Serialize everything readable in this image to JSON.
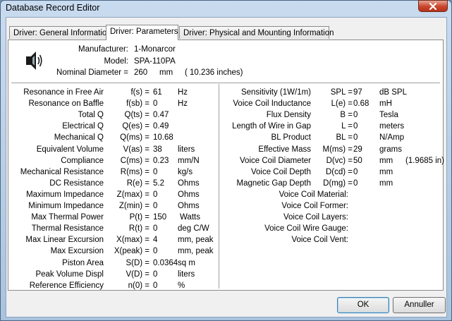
{
  "window": {
    "title": "Database Record Editor"
  },
  "tabs": [
    {
      "label": "Driver:  General Information"
    },
    {
      "label": "Driver:  Parameters"
    },
    {
      "label": "Driver:  Physical and Mounting Information"
    }
  ],
  "header": {
    "manufacturer_label": "Manufacturer:",
    "manufacturer_value": "1-Monarcor",
    "model_label": "Model:",
    "model_value": "SPA-110PA",
    "diameter_label": "Nominal Diameter =",
    "diameter_value": "260",
    "diameter_unit": "mm",
    "diameter_inches": "( 10.236 inches)"
  },
  "left_params": [
    {
      "label": "Resonance in Free Air",
      "sym": "f(s) =",
      "value": "61",
      "unit": "Hz"
    },
    {
      "label": "Resonance on Baffle",
      "sym": "f(sb) =",
      "value": "0",
      "unit": "Hz"
    },
    {
      "label": "Total Q",
      "sym": "Q(ts) =",
      "value": "0.47",
      "unit": ""
    },
    {
      "label": "Electrical Q",
      "sym": "Q(es) =",
      "value": "0.49",
      "unit": ""
    },
    {
      "label": "Mechanical Q",
      "sym": "Q(ms) =",
      "value": "10.68",
      "unit": ""
    },
    {
      "label": "Equivalent Volume",
      "sym": "V(as) =",
      "value": "38",
      "unit": "liters"
    },
    {
      "label": "Compliance",
      "sym": "C(ms) =",
      "value": "0.23",
      "unit": "mm/N"
    },
    {
      "label": "Mechanical Resistance",
      "sym": "R(ms) =",
      "value": "0",
      "unit": "kg/s"
    },
    {
      "label": "DC Resistance",
      "sym": "R(e) =",
      "value": "5.2",
      "unit": "Ohms"
    },
    {
      "label": "Maximum Impedance",
      "sym": "Z(max) =",
      "value": "0",
      "unit": "Ohms"
    },
    {
      "label": "Minimum Impedance",
      "sym": "Z(min) =",
      "value": "0",
      "unit": "Ohms"
    },
    {
      "label": "Max Thermal Power",
      "sym": "P(t) =",
      "value": "150",
      "unit": "Watts"
    },
    {
      "label": "Thermal Resistance",
      "sym": "R(t) =",
      "value": "0",
      "unit": "deg C/W"
    },
    {
      "label": "Max Linear Excursion",
      "sym": "X(max) =",
      "value": "4",
      "unit": "mm, peak"
    },
    {
      "label": "Max Excursion",
      "sym": "X(peak) =",
      "value": "0",
      "unit": "mm, peak"
    },
    {
      "label": "Piston Area",
      "sym": "S(D) =",
      "value": "0.0364",
      "unit": "sq m"
    },
    {
      "label": "Peak Volume Displ",
      "sym": "V(D) =",
      "value": "0",
      "unit": "liters"
    },
    {
      "label": "Reference Efficiency",
      "sym": "n(0) =",
      "value": "0",
      "unit": "%"
    }
  ],
  "right_params": [
    {
      "label": "Sensitivity (1W/1m)",
      "sym": "SPL =",
      "value": "97",
      "unit": "dB SPL",
      "extra": ""
    },
    {
      "label": "Voice Coil Inductance",
      "sym": "L(e) =",
      "value": "0.68",
      "unit": "mH",
      "extra": ""
    },
    {
      "label": "Flux Density",
      "sym": "B =",
      "value": "0",
      "unit": "Tesla",
      "extra": ""
    },
    {
      "label": "Length of Wire in Gap",
      "sym": "L =",
      "value": "0",
      "unit": "meters",
      "extra": ""
    },
    {
      "label": "BL Product",
      "sym": "BL =",
      "value": "0",
      "unit": "N/Amp",
      "extra": ""
    },
    {
      "label": "Effective Mass",
      "sym": "M(ms) =",
      "value": "29",
      "unit": "grams",
      "extra": ""
    },
    {
      "label": "Voice Coil Diameter",
      "sym": "D(vc) =",
      "value": "50",
      "unit": "mm",
      "extra": "(1.9685  in)"
    },
    {
      "label": "Voice Coil Depth",
      "sym": "D(cd) =",
      "value": "0",
      "unit": "mm",
      "extra": ""
    },
    {
      "label": "Magnetic Gap Depth",
      "sym": "D(mg) =",
      "value": "0",
      "unit": "mm",
      "extra": ""
    }
  ],
  "coil_info": [
    {
      "label": "Voice Coil Material:",
      "value": ""
    },
    {
      "label": "Voice Coil Former:",
      "value": ""
    },
    {
      "label": "Voice Coil Layers:",
      "value": ""
    },
    {
      "label": "Voice Coil Wire Gauge:",
      "value": ""
    },
    {
      "label": "Voice Coil Vent:",
      "value": ""
    }
  ],
  "buttons": {
    "ok": "OK",
    "cancel": "Annuller"
  }
}
